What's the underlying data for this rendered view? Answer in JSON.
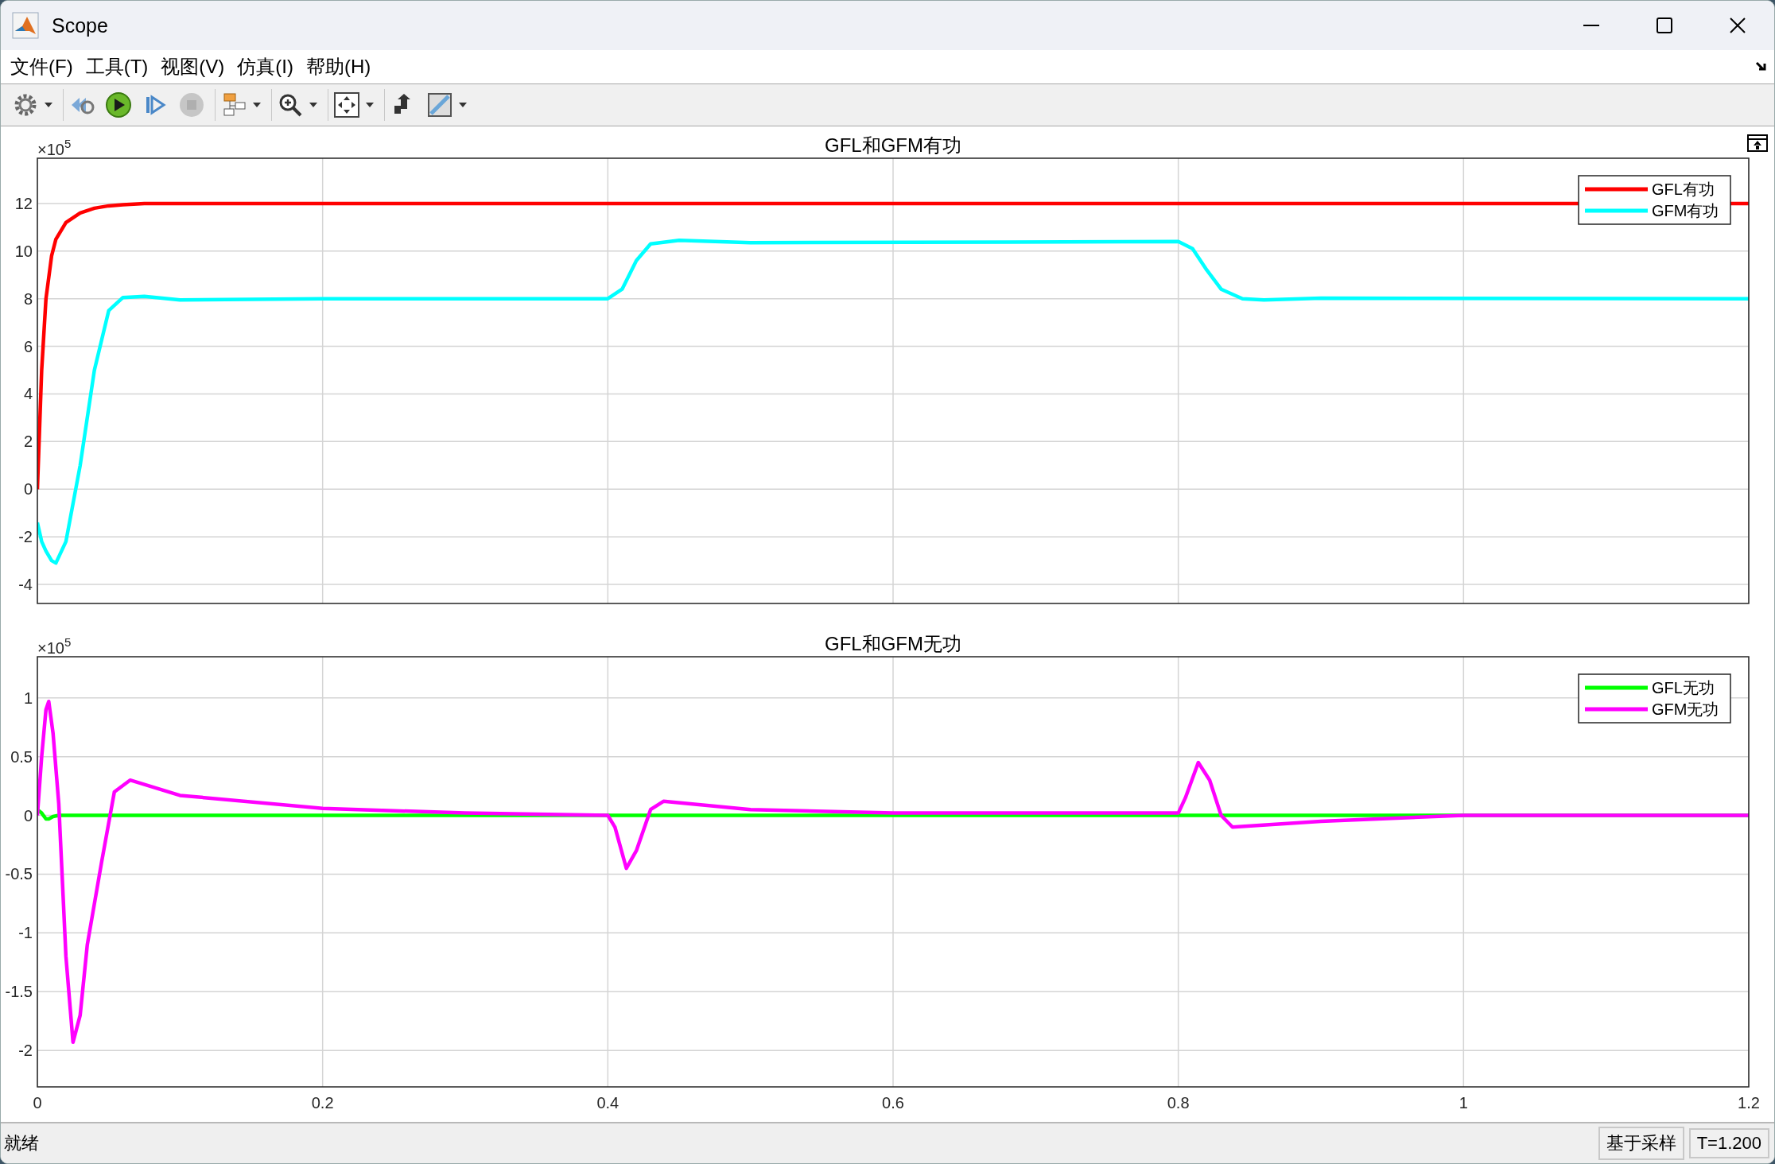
{
  "window": {
    "title": "Scope"
  },
  "menu": [
    {
      "label": "文件(F)"
    },
    {
      "label": "工具(T)"
    },
    {
      "label": "视图(V)"
    },
    {
      "label": "仿真(I)"
    },
    {
      "label": "帮助(H)"
    }
  ],
  "toolbar": [
    [
      {
        "kind": "settings",
        "dropdown": true,
        "disabled": false
      }
    ],
    [
      {
        "kind": "step_back",
        "dropdown": false,
        "disabled": false
      },
      {
        "kind": "run",
        "dropdown": false,
        "disabled": false
      },
      {
        "kind": "step_forward",
        "dropdown": false,
        "disabled": false
      },
      {
        "kind": "stop",
        "dropdown": false,
        "disabled": true
      }
    ],
    [
      {
        "kind": "blocks",
        "dropdown": true,
        "disabled": false
      }
    ],
    [
      {
        "kind": "zoom",
        "dropdown": true,
        "disabled": false
      }
    ],
    [
      {
        "kind": "fit",
        "dropdown": true,
        "disabled": false
      }
    ],
    [
      {
        "kind": "highlight",
        "dropdown": false,
        "disabled": false
      },
      {
        "kind": "style",
        "dropdown": true,
        "disabled": false
      }
    ]
  ],
  "plots": [
    {
      "exponent_label": "×10$^{5}$",
      "chart_data": {
        "type": "line",
        "title": "GFL和GFM有功",
        "grid": true,
        "legend": true,
        "xlim": [
          0,
          1.2
        ],
        "ylim": [
          -4.8,
          13.9
        ],
        "yticks": [
          -4,
          -2,
          0,
          2,
          4,
          6,
          8,
          10,
          12
        ],
        "x": [
          0,
          0.003,
          0.006,
          0.01,
          0.013,
          0.02,
          0.03,
          0.04,
          0.05,
          0.06,
          0.075,
          0.1,
          0.2,
          0.4,
          0.41,
          0.42,
          0.43,
          0.45,
          0.5,
          0.8,
          0.81,
          0.82,
          0.83,
          0.845,
          0.86,
          0.9,
          1.2
        ],
        "series": [
          {
            "name": "GFL有功",
            "color": "#ff0000",
            "values": [
              0,
              5,
              8,
              9.8,
              10.5,
              11.2,
              11.6,
              11.8,
              11.9,
              11.95,
              12,
              12,
              12,
              12,
              12,
              12,
              12,
              12,
              12,
              12,
              12,
              12,
              12,
              12,
              12,
              12,
              12
            ]
          },
          {
            "name": "GFM有功",
            "color": "#00ffff",
            "values": [
              -1.4,
              -2.2,
              -2.6,
              -3,
              -3.1,
              -2.2,
              1,
              5,
              7.5,
              8.05,
              8.1,
              7.95,
              8,
              8,
              8.4,
              9.6,
              10.3,
              10.45,
              10.35,
              10.4,
              10.1,
              9.2,
              8.4,
              8,
              7.95,
              8.02,
              8
            ]
          }
        ]
      }
    },
    {
      "exponent_label": "×10$^{5}$",
      "chart_data": {
        "type": "line",
        "title": "GFL和GFM无功",
        "grid": true,
        "legend": true,
        "xlim": [
          0,
          1.2
        ],
        "ylim": [
          -2.31,
          1.35
        ],
        "xticks": [
          0,
          0.2,
          0.4,
          0.6,
          0.8,
          1,
          1.2
        ],
        "yticks": [
          -2,
          -1.5,
          -1,
          -0.5,
          0,
          0.5,
          1
        ],
        "x": [
          0,
          0.003,
          0.006,
          0.008,
          0.011,
          0.015,
          0.02,
          0.025,
          0.03,
          0.035,
          0.045,
          0.054,
          0.065,
          0.1,
          0.2,
          0.3,
          0.4,
          0.405,
          0.413,
          0.42,
          0.43,
          0.439,
          0.5,
          0.6,
          0.8,
          0.805,
          0.814,
          0.822,
          0.83,
          0.838,
          0.9,
          1,
          1.2
        ],
        "series": [
          {
            "name": "GFL无功",
            "color": "#00ff00",
            "values": [
              0.05,
              0.02,
              -0.03,
              -0.03,
              -0.01,
              0,
              0,
              0,
              0,
              0,
              0,
              0,
              0,
              0,
              0,
              0,
              0,
              0,
              0,
              0,
              0,
              0,
              0,
              0,
              0,
              0,
              0,
              0,
              0,
              0,
              0,
              0,
              0
            ]
          },
          {
            "name": "GFM无功",
            "color": "#ff00ff",
            "values": [
              0,
              0.5,
              0.9,
              0.97,
              0.7,
              0.1,
              -1.2,
              -1.93,
              -1.7,
              -1.1,
              -0.4,
              0.2,
              0.3,
              0.17,
              0.06,
              0.02,
              0,
              -0.1,
              -0.45,
              -0.3,
              0.05,
              0.12,
              0.05,
              0.02,
              0.02,
              0.15,
              0.45,
              0.3,
              0,
              -0.1,
              -0.05,
              0,
              0
            ]
          }
        ]
      }
    }
  ],
  "status_bar": {
    "message": "就绪",
    "mode": "基于采样",
    "time": "T=1.200"
  }
}
